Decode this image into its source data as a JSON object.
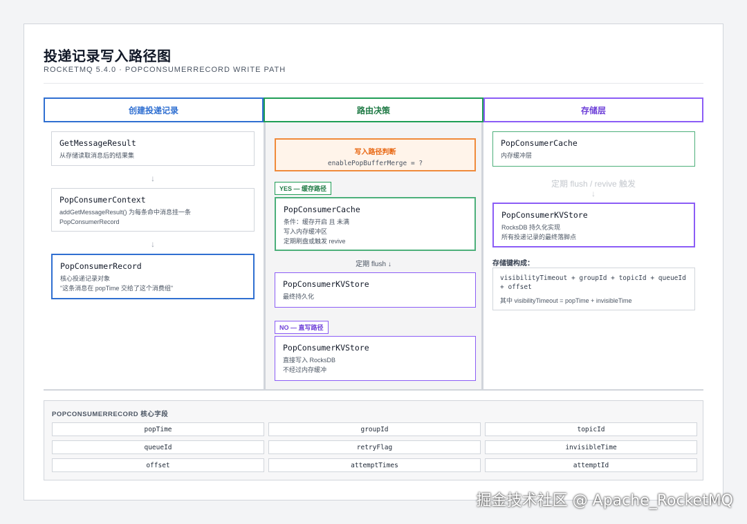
{
  "header": {
    "title": "投递记录写入路径图",
    "subtitle": "ROCKETMQ 5.4.0 · POPCONSUMERRECORD WRITE PATH"
  },
  "columns": {
    "create": {
      "label": "创建投递记录"
    },
    "route": {
      "label": "路由决策"
    },
    "storage": {
      "label": "存储层"
    }
  },
  "create": {
    "cards": [
      {
        "title": "GetMessageResult",
        "desc": [
          "从存储读取消息后的结果集"
        ]
      },
      {
        "title": "PopConsumerContext",
        "desc": [
          "addGetMessageResult() 为每条命中消息挂一条",
          "PopConsumerRecord"
        ]
      },
      {
        "title": "PopConsumerRecord",
        "desc": [
          "核心投递记录对象",
          "\"这条消息在 popTime 交给了这个消费组\""
        ]
      }
    ],
    "arrow": "↓"
  },
  "route": {
    "decision": {
      "title": "写入路径判断",
      "code": "enablePopBufferMerge = ?"
    },
    "yes_tag": "YES — 缓存路径",
    "no_tag": "NO — 直写路径",
    "yes_cache": {
      "title": "PopConsumerCache",
      "desc": [
        "条件：缓存开启 且 未满",
        "写入内存缓冲区",
        "定期刷盘或触发 revive"
      ]
    },
    "flush_note": "定期 flush ↓",
    "yes_kv": {
      "title": "PopConsumerKVStore",
      "desc": [
        "最终持久化"
      ]
    },
    "no_kv": {
      "title": "PopConsumerKVStore",
      "desc": [
        "直接写入 RocksDB",
        "不经过内存缓冲"
      ]
    }
  },
  "storage": {
    "cache": {
      "title": "PopConsumerCache",
      "desc": [
        "内存缓冲层"
      ]
    },
    "trigger_note": "定期 flush / revive 触发",
    "arrow": "↓",
    "kv": {
      "title": "PopConsumerKVStore",
      "desc": [
        "RocksDB 持久化实现",
        "所有投递记录的最终落脚点"
      ]
    },
    "key_label": "存储键构成：",
    "key": {
      "expr": [
        "visibilityTimeout + groupId + topicId + queueId",
        "+ offset"
      ],
      "note": "其中 visibilityTimeout = popTime + invisibleTime"
    }
  },
  "fields": {
    "title": "POPCONSUMERRECORD 核心字段",
    "items": [
      "popTime",
      "groupId",
      "topicId",
      "queueId",
      "retryFlag",
      "invisibleTime",
      "offset",
      "attemptTimes",
      "attemptId"
    ]
  },
  "watermark": "掘金技术社区 @ Apache_RocketMQ",
  "colors": {
    "blue": "#2f6fd1",
    "green": "#1f9d55",
    "purple": "#8b5cf6",
    "orange": "#ef8a3a"
  }
}
